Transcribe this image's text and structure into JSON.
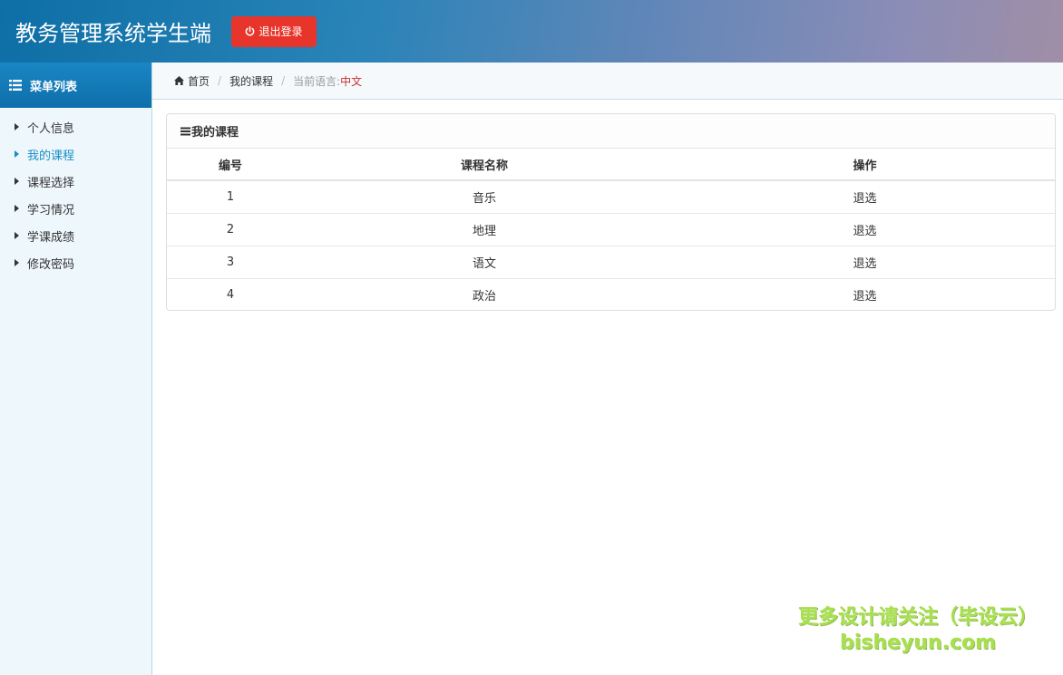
{
  "header": {
    "title": "教务管理系统学生端",
    "logout_label": "退出登录"
  },
  "sidebar": {
    "heading": "菜单列表",
    "items": [
      {
        "label": "个人信息"
      },
      {
        "label": "我的课程"
      },
      {
        "label": "课程选择"
      },
      {
        "label": "学习情况"
      },
      {
        "label": "学课成绩"
      },
      {
        "label": "修改密码"
      }
    ],
    "active_index": 1
  },
  "breadcrumb": {
    "home": "首页",
    "current": "我的课程",
    "lang_label": "当前语言:",
    "lang_value": "中文"
  },
  "panel": {
    "title": "我的课程",
    "columns": [
      "编号",
      "课程名称",
      "操作"
    ],
    "rows": [
      {
        "id": "1",
        "name": "音乐",
        "action": "退选"
      },
      {
        "id": "2",
        "name": "地理",
        "action": "退选"
      },
      {
        "id": "3",
        "name": "语文",
        "action": "退选"
      },
      {
        "id": "4",
        "name": "政治",
        "action": "退选"
      }
    ]
  },
  "watermark": {
    "line1": "更多设计请关注（毕设云）",
    "line2": "bisheyun.com"
  },
  "colors": {
    "logout_button": "#e8352b",
    "active_menu": "#1a8fc6",
    "lang_value": "#c9302c",
    "watermark": "#a6e04a"
  }
}
